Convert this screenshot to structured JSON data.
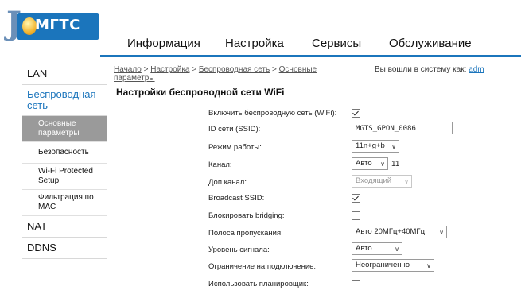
{
  "header": {
    "logo_text": "МГТС",
    "nav": [
      "Информация",
      "Настройка",
      "Сервисы",
      "Обслуживание"
    ]
  },
  "sidebar": {
    "items": [
      {
        "label": "LAN"
      },
      {
        "label": "Беспроводная сеть"
      },
      {
        "label": "Основные параметры"
      },
      {
        "label": "Безопасность"
      },
      {
        "label": "Wi-Fi Protected Setup"
      },
      {
        "label": "Фильтрация по MAC"
      },
      {
        "label": "NAT"
      },
      {
        "label": "DDNS"
      }
    ]
  },
  "breadcrumb": {
    "items": [
      "Начало",
      "Настройка",
      "Беспроводная сеть",
      "Основные параметры"
    ],
    "sep": " > "
  },
  "login": {
    "prefix": "Вы вошли в систему как:",
    "user": "adm"
  },
  "page_title": "Настройки беспроводной сети WiFi",
  "form": {
    "enable_wifi": {
      "label": "Включить беспроводную сеть (WiFi):",
      "checked": true
    },
    "ssid": {
      "label": "ID сети (SSID):",
      "value": "MGTS_GPON_0086"
    },
    "mode": {
      "label": "Режим работы:",
      "value": "11n+g+b"
    },
    "channel": {
      "label": "Канал:",
      "value": "Авто",
      "current": "11"
    },
    "ext_channel": {
      "label": "Доп.канал:",
      "value": "Входящий"
    },
    "broadcast_ssid": {
      "label": "Broadcast SSID:",
      "checked": true
    },
    "block_bridging": {
      "label": "Блокировать bridging:",
      "checked": false
    },
    "bandwidth": {
      "label": "Полоса пропускания:",
      "value": "Авто 20МГц+40МГц"
    },
    "signal_level": {
      "label": "Уровень сигнала:",
      "value": "Авто"
    },
    "conn_limit": {
      "label": "Ограничение на подключение:",
      "value": "Неограниченно"
    },
    "scheduler": {
      "label": "Использовать планировщик:",
      "checked": false
    }
  },
  "colors": {
    "accent": "#1b75bc",
    "active_bg": "#9a9a9a"
  }
}
